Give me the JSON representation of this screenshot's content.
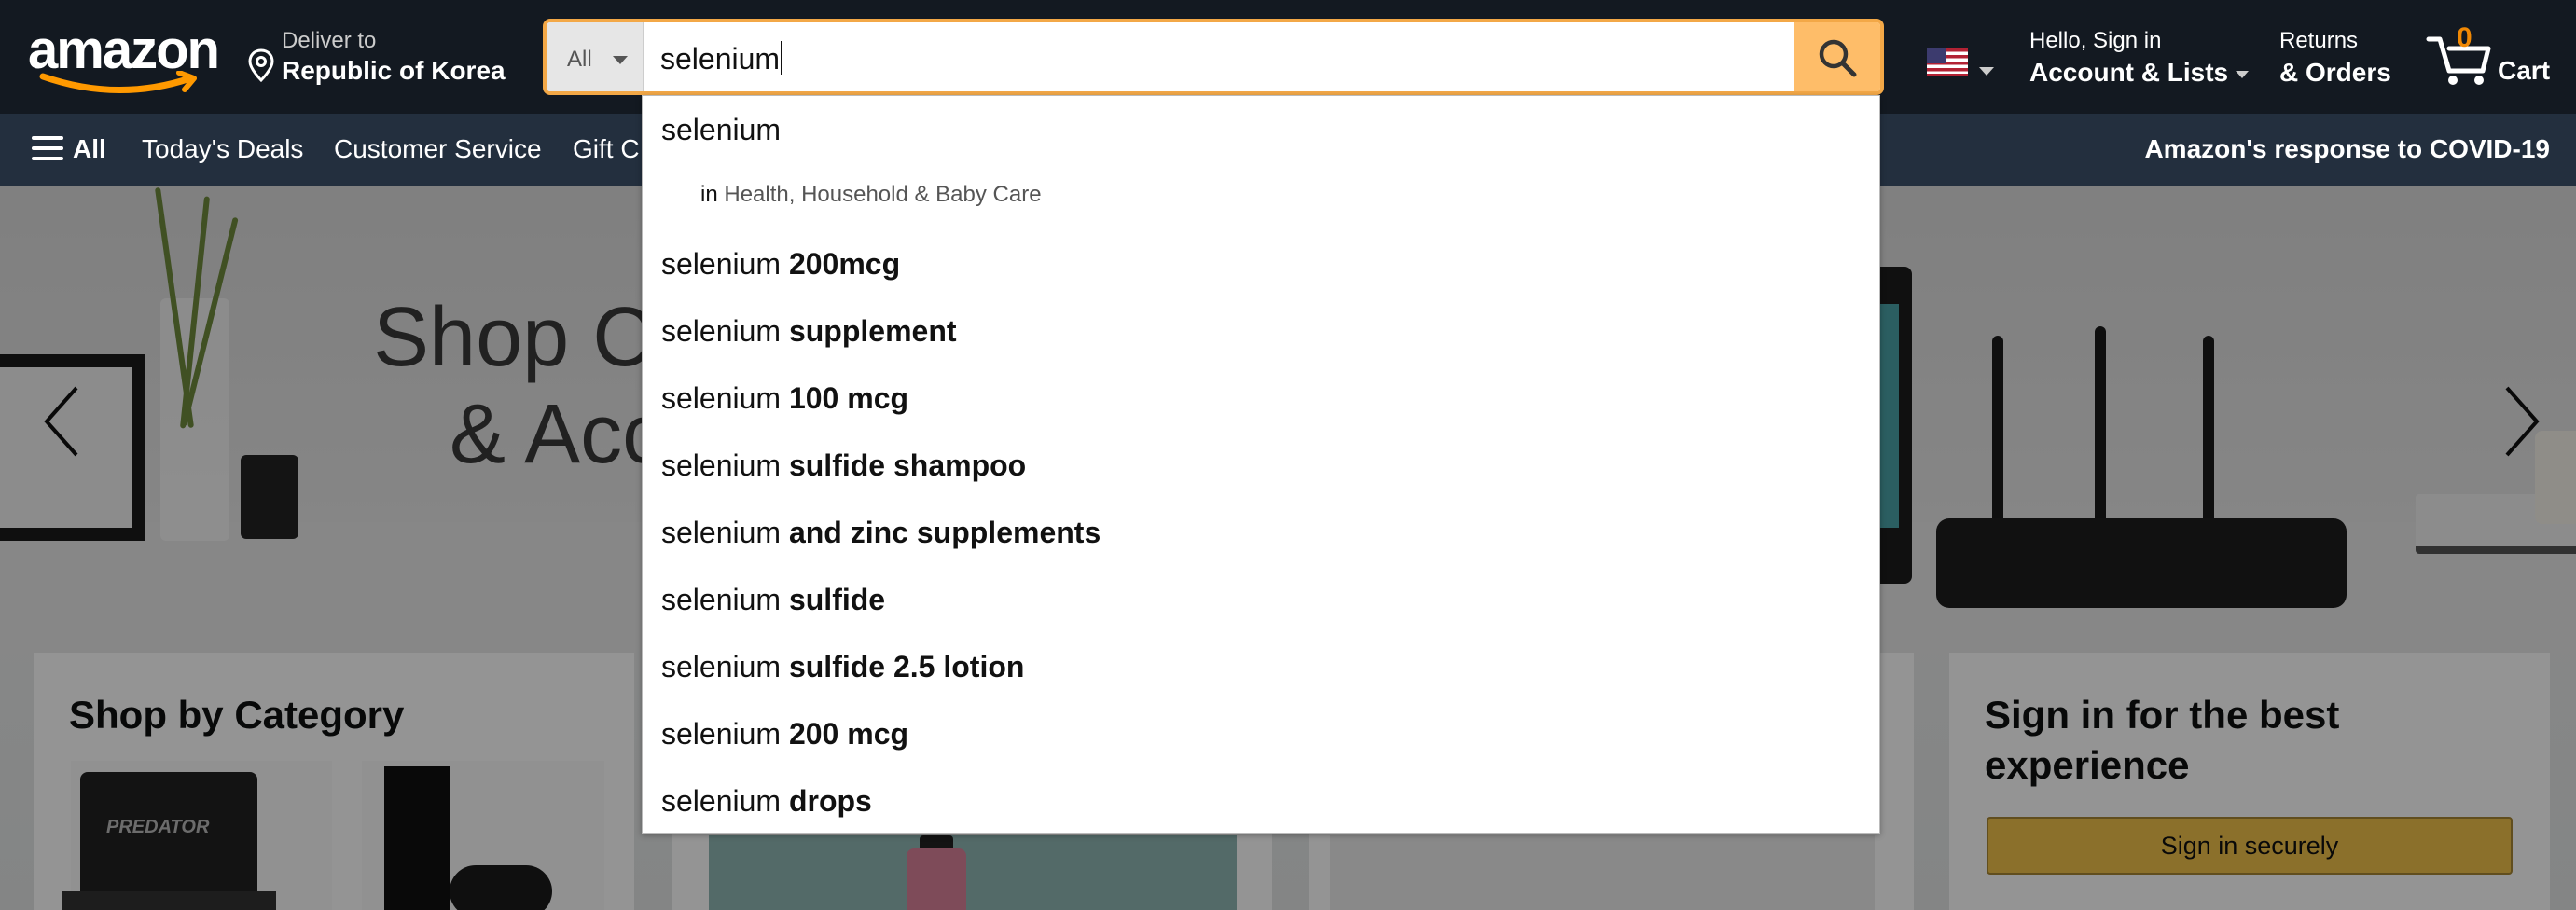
{
  "header": {
    "logo_text": "amazon",
    "deliver_line1": "Deliver to",
    "deliver_line2": "Republic of Korea",
    "search": {
      "category": "All",
      "query": "selenium",
      "button_icon": "search-icon"
    },
    "flag_icon": "us-flag-icon",
    "account_line1": "Hello, Sign in",
    "account_line2": "Account & Lists",
    "returns_line1": "Returns",
    "returns_line2": "& Orders",
    "cart_count": "0",
    "cart_label": "Cart"
  },
  "subnav": {
    "all_label": "All",
    "links": [
      "Today's Deals",
      "Customer Service",
      "Gift C"
    ],
    "covid": "Amazon's response to COVID-19"
  },
  "hero": {
    "title_line1": "Shop C",
    "title_line2": "& Acc"
  },
  "cards": {
    "category_title": "Shop by Category",
    "laptop_brand": "PREDATOR",
    "signin_title": "Sign in for the best experience",
    "signin_button": "Sign in securely"
  },
  "suggestions": {
    "first": "selenium",
    "dept_prefix": "in",
    "dept_name": "Health, Household & Baby Care",
    "items": [
      {
        "prefix": "selenium",
        "suffix": "200mcg"
      },
      {
        "prefix": "selenium",
        "suffix": "supplement"
      },
      {
        "prefix": "selenium",
        "suffix": "100 mcg"
      },
      {
        "prefix": "selenium",
        "suffix": "sulfide shampoo"
      },
      {
        "prefix": "selenium",
        "suffix": "and zinc supplements"
      },
      {
        "prefix": "selenium",
        "suffix": "sulfide"
      },
      {
        "prefix": "selenium",
        "suffix": "sulfide 2.5 lotion"
      },
      {
        "prefix": "selenium",
        "suffix": "200 mcg"
      },
      {
        "prefix": "selenium",
        "suffix": "drops"
      }
    ]
  },
  "colors": {
    "nav_top": "#131921",
    "nav_sub": "#232f3e",
    "search_accent": "#febd69",
    "focus_border": "#f3a847",
    "cart_count": "#f08804",
    "signin_button": "#f0c14b"
  }
}
